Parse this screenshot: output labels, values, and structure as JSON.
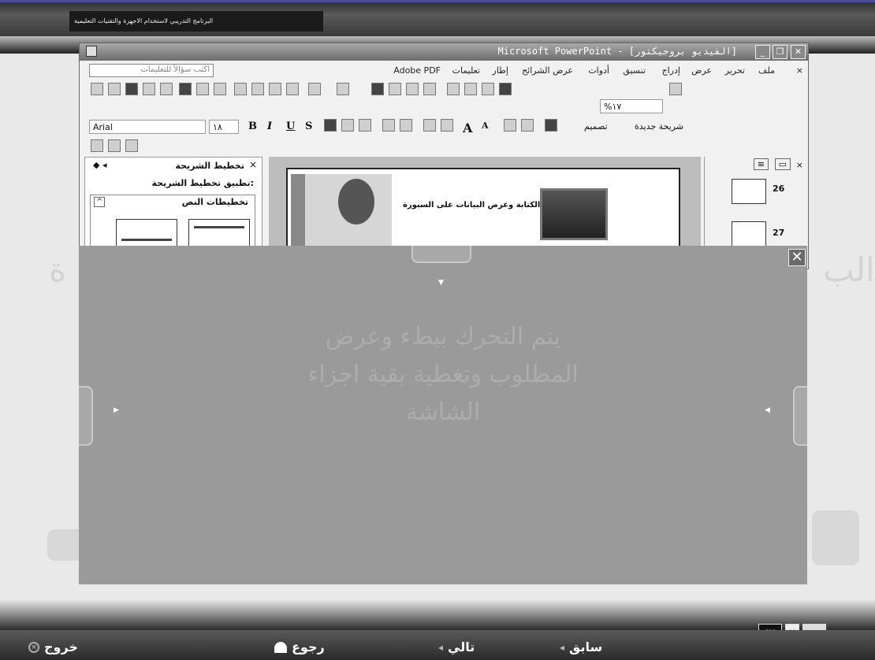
{
  "top": {
    "program_title": "البرنامج التدريبي لاستخدام الاجهزة والتقنيات التعليمية"
  },
  "background": {
    "watermark_left": "ة",
    "watermark_right": "الب"
  },
  "window": {
    "title": "Microsoft PowerPoint - [الفيديو بروجيكتور]",
    "buttons": {
      "minimize": "_",
      "restore": "❐",
      "close": "✕"
    }
  },
  "menu": {
    "items": [
      "ملف",
      "تحرير",
      "عرض",
      "إدراج",
      "تنسيق",
      "أدوات",
      "عرض الشرائح",
      "إطار",
      "تعليمات",
      "Adobe PDF"
    ],
    "close": "×",
    "ask_placeholder": "اكتب سؤالاً للتعليمات"
  },
  "toolbar": {
    "zoom": "%١٧",
    "font": "Arial",
    "font_size": "١٨",
    "bold": "B",
    "italic": "I",
    "underline": "U",
    "shadow": "S",
    "font_grow": "A",
    "font_shrink": "A",
    "design": "تصميم",
    "new_slide": "شريحة جديدة"
  },
  "task_pane": {
    "title": "تخطيط الشريحة",
    "close": "×",
    "subtitle": "تطبيق تخطيط الشريحة:",
    "group_title": "تخطيطات النص"
  },
  "slide": {
    "caption": "الكتابة وعرض البيانات على السبورة"
  },
  "thumbnails": {
    "items": [
      "26",
      "27"
    ]
  },
  "overlay": {
    "close": "✕",
    "message": "يتم التحرك ببطء وعرض المطلوب وتغطية بقية اجزاء الشاشة"
  },
  "nav": {
    "exit": "خروج",
    "back": "رجوع",
    "next": "تالي",
    "previous": "سابق",
    "logo_sm": "SM",
    "logo_y": "Y"
  }
}
